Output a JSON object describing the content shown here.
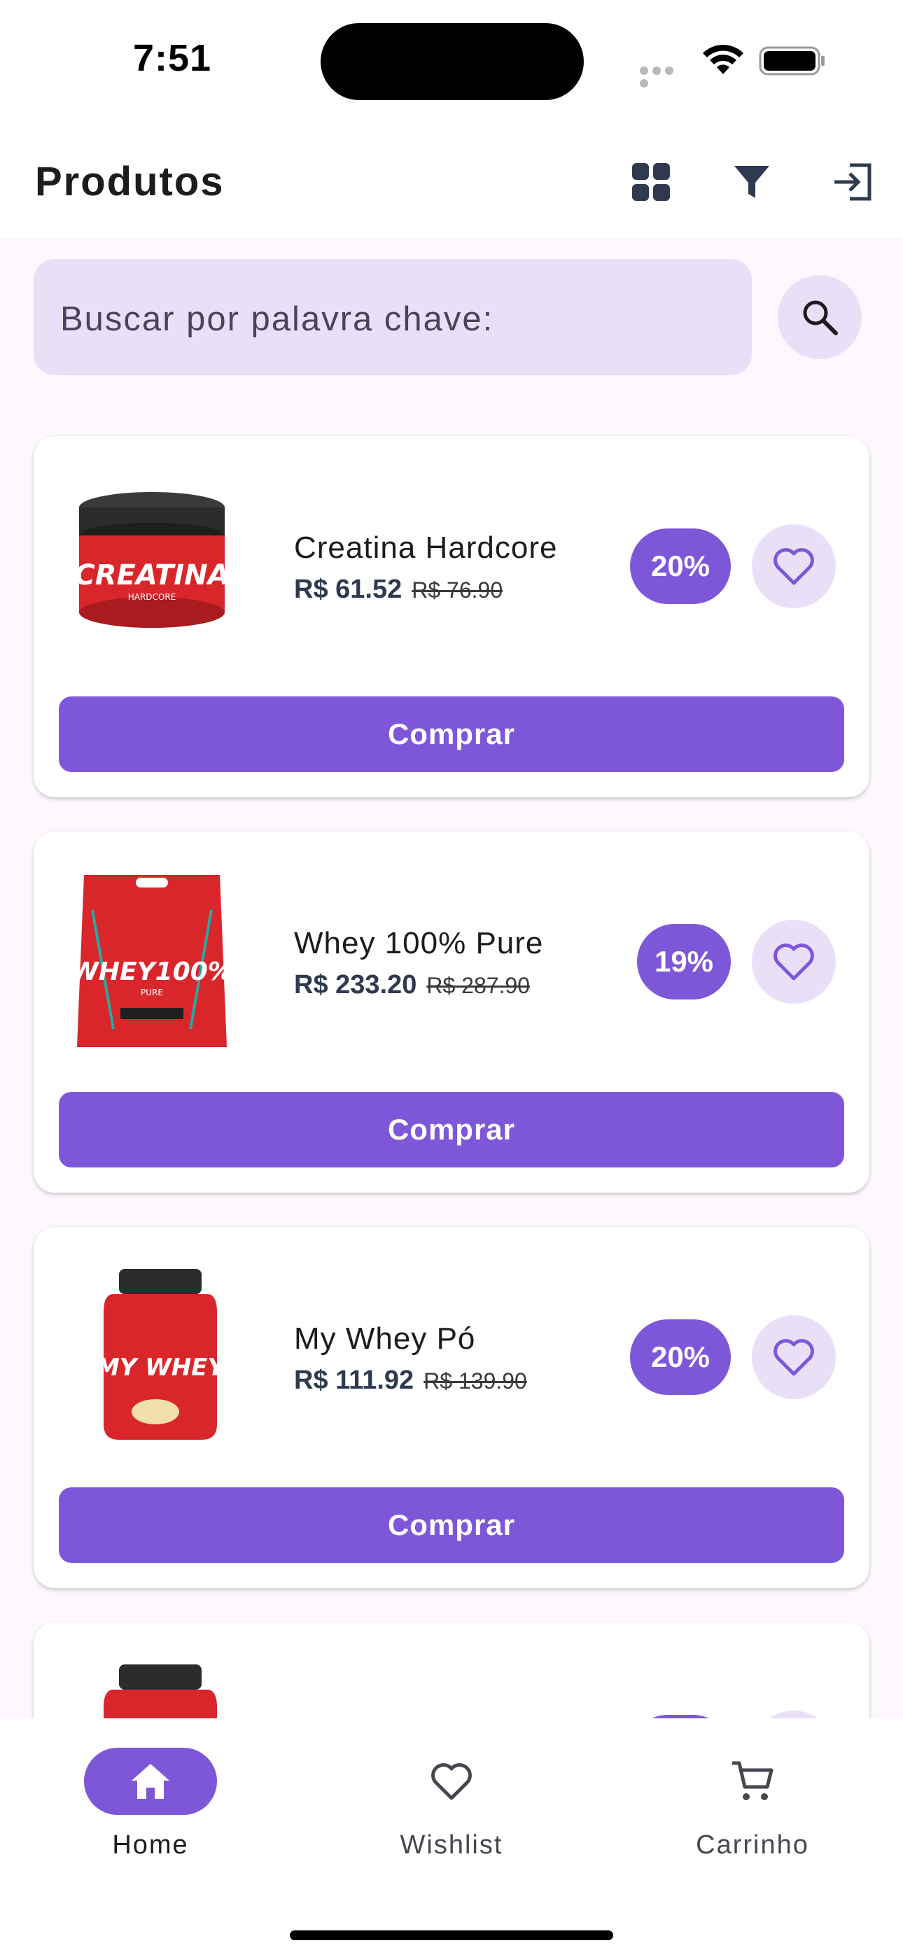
{
  "status_bar": {
    "time": "7:51"
  },
  "app_bar": {
    "title": "Produtos"
  },
  "search": {
    "placeholder": "Buscar por palavra chave:"
  },
  "products": [
    {
      "name": "Creatina Hardcore",
      "price": "R$ 61.52",
      "old_price": "R$ 76.90",
      "discount": "20%",
      "buy_label": "Comprar",
      "image_label": "CREATINA",
      "image_sub": "HARDCORE"
    },
    {
      "name": "Whey 100% Pure",
      "price": "R$ 233.20",
      "old_price": "R$ 287.90",
      "discount": "19%",
      "buy_label": "Comprar",
      "image_label": "WHEY100%",
      "image_sub": "PURE"
    },
    {
      "name": "My Whey Pó",
      "price": "R$ 111.92",
      "old_price": "R$ 139.90",
      "discount": "20%",
      "buy_label": "Comprar",
      "image_label": "MY WHEY",
      "image_sub": ""
    }
  ],
  "bottom_nav": {
    "items": [
      {
        "label": "Home",
        "icon": "home-icon",
        "active": true
      },
      {
        "label": "Wishlist",
        "icon": "heart-outline-icon",
        "active": false
      },
      {
        "label": "Carrinho",
        "icon": "cart-icon",
        "active": false
      }
    ]
  },
  "colors": {
    "primary": "#7e57d9",
    "tonal": "#e9e0f8",
    "background": "#fdf8fd"
  }
}
